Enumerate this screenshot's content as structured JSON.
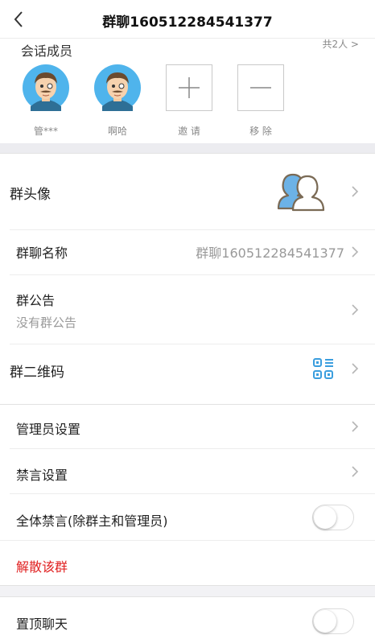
{
  "navbar": {
    "title": "群聊160512284541377",
    "back_icon": "chevron-left-icon"
  },
  "members": {
    "title": "会话成员",
    "count_link": "共2人 >",
    "list": [
      {
        "name": "管***",
        "avatar": "cartoon-man-avatar"
      },
      {
        "name": "啊哈",
        "avatar": "cartoon-man-avatar"
      }
    ],
    "invite_label": "邀 请",
    "remove_label": "移 除"
  },
  "settings": {
    "group_avatar_label": "群头像",
    "group_name_label": "群聊名称",
    "group_name_value": "群聊160512284541377",
    "announcement_label": "群公告",
    "announcement_value": "没有群公告",
    "qr_label": "群二维码"
  },
  "admin": {
    "admin_settings_label": "管理员设置",
    "mute_settings_label": "禁言设置",
    "mute_all_label": "全体禁言(除群主和管理员)",
    "mute_all_on": false,
    "dissolve_label": "解散该群"
  },
  "chat": {
    "pin_label": "置顶聊天",
    "pin_on": false
  },
  "colors": {
    "danger": "#e02020",
    "avatar_bg": "#4fb4ec",
    "qr_blue": "#3b9ede"
  }
}
